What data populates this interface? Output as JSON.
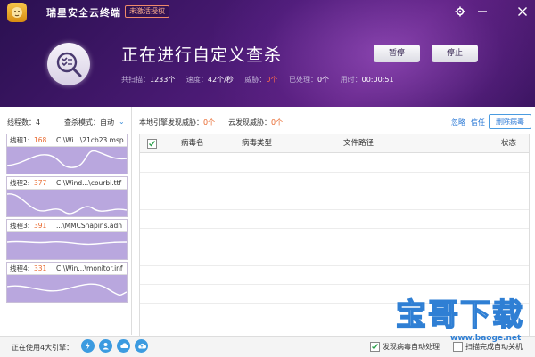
{
  "header": {
    "app_name": "瑞星安全云终端",
    "license_badge": "未激活授权",
    "scan_title": "正在进行自定义查杀",
    "pause_label": "暂停",
    "stop_label": "停止",
    "stats": {
      "scanned_label": "共扫描：",
      "scanned_value": "1233个",
      "speed_label": "速度：",
      "speed_value": "42个/秒",
      "threats_label": "威胁：",
      "threats_value": "0个",
      "processed_label": "已处理：",
      "processed_value": "0个",
      "time_label": "用时：",
      "time_value": "00:00:51"
    }
  },
  "threads": {
    "count_label": "线程数：4",
    "mode_label": "查杀模式：自动",
    "items": [
      {
        "label": "线程1:",
        "count": "168",
        "file": "C:\\Wi...\\21cb23.msp",
        "progress": 0.35
      },
      {
        "label": "线程2:",
        "count": "377",
        "file": "C:\\Wind...\\courbi.ttf",
        "progress": 0.55
      },
      {
        "label": "线程3:",
        "count": "391",
        "file": "...\\MMCSnapins.adn",
        "progress": 0.5
      },
      {
        "label": "线程4:",
        "count": "331",
        "file": "C:\\Win...\\monitor.inf",
        "progress": 0.6
      }
    ]
  },
  "results": {
    "local_label": "本地引擎发现威胁：",
    "local_count": "0个",
    "cloud_label": "云发现威胁：",
    "cloud_count": "0个",
    "ignore_label": "忽略",
    "trust_label": "信任",
    "delete_label": "删除病毒",
    "columns": [
      "病毒名",
      "病毒类型",
      "文件路径",
      "状态"
    ]
  },
  "statusbar": {
    "engines_label": "正在使用4大引擎：",
    "auto_process_label": "发现病毒自动处理",
    "auto_process_checked": true,
    "shutdown_label": "扫描完成自动关机",
    "shutdown_checked": false
  },
  "watermark": {
    "text": "宝哥下载",
    "url": "www.baoge.net"
  },
  "colors": {
    "header_bg": "#4a1a74",
    "accent": "#2c7ad6",
    "warn": "#e8662a",
    "chart_fill": "#b9a7de"
  }
}
